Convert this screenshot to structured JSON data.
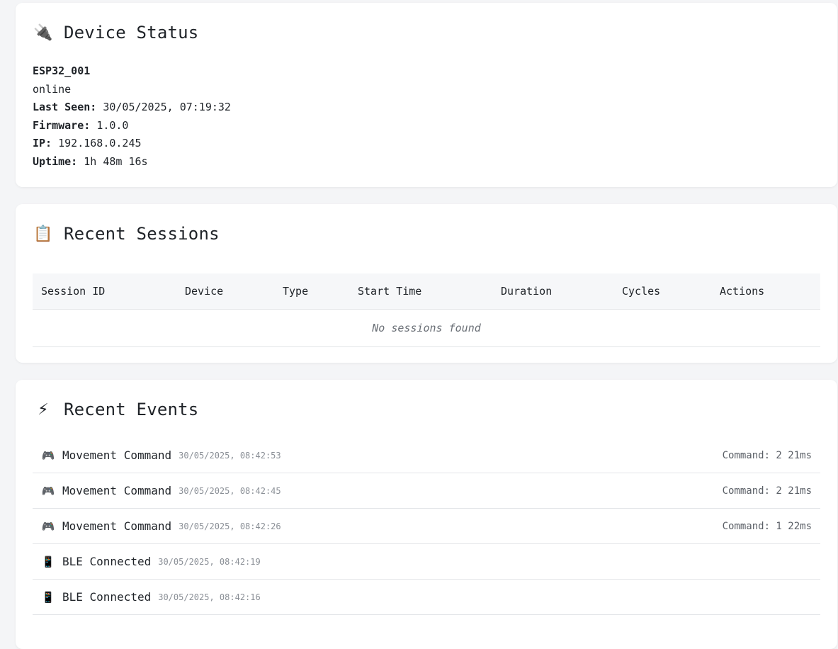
{
  "device_status": {
    "title": "Device Status",
    "icon": "plug-icon",
    "device_name": "ESP32_001",
    "status": "online",
    "last_seen_label": "Last Seen:",
    "last_seen": "30/05/2025, 07:19:32",
    "firmware_label": "Firmware:",
    "firmware": "1.0.0",
    "ip_label": "IP:",
    "ip": "192.168.0.245",
    "uptime_label": "Uptime:",
    "uptime": "1h 48m 16s"
  },
  "sessions": {
    "title": "Recent Sessions",
    "icon": "clipboard-icon",
    "columns": [
      "Session ID",
      "Device",
      "Type",
      "Start Time",
      "Duration",
      "Cycles",
      "Actions"
    ],
    "empty_text": "No sessions found"
  },
  "events": {
    "title": "Recent Events",
    "icon": "lightning-icon",
    "items": [
      {
        "icon": "gamepad-icon",
        "name": "Movement Command",
        "time": "30/05/2025, 08:42:53",
        "detail": "Command: 2 21ms"
      },
      {
        "icon": "gamepad-icon",
        "name": "Movement Command",
        "time": "30/05/2025, 08:42:45",
        "detail": "Command: 2 21ms"
      },
      {
        "icon": "gamepad-icon",
        "name": "Movement Command",
        "time": "30/05/2025, 08:42:26",
        "detail": "Command: 1 22ms"
      },
      {
        "icon": "phone-icon",
        "name": "BLE Connected",
        "time": "30/05/2025, 08:42:19",
        "detail": ""
      },
      {
        "icon": "phone-icon",
        "name": "BLE Connected",
        "time": "30/05/2025, 08:42:16",
        "detail": ""
      }
    ]
  }
}
